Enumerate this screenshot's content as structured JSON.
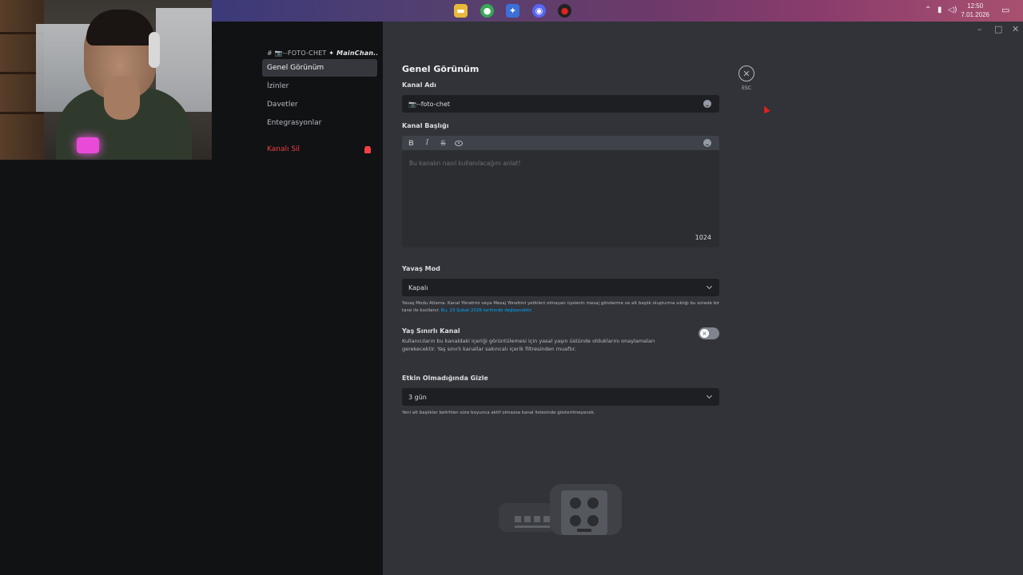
{
  "taskbar": {
    "clock_time": "12:50",
    "clock_date": "7.01.2026"
  },
  "sidebar": {
    "header_channel": "# 📷--FOTO-CHET",
    "header_category": "✦ MainChan...",
    "items": [
      {
        "label": "Genel Görünüm",
        "active": true
      },
      {
        "label": "İzinler"
      },
      {
        "label": "Davetler"
      },
      {
        "label": "Entegrasyonlar"
      }
    ],
    "delete_label": "Kanalı Sil"
  },
  "main": {
    "title": "Genel Görünüm",
    "channel_name_label": "Kanal Adı",
    "channel_name_value": "📷--foto-chet",
    "topic_label": "Kanal Başlığı",
    "topic_placeholder": "Bu kanalın nasıl kullanılacağını anlat!",
    "topic_counter": "1024",
    "toolbar": {
      "bold": "B",
      "italic": "I",
      "strike": "S"
    },
    "slowmode_label": "Yavaş Mod",
    "slowmode_value": "Kapalı",
    "slowmode_help": "Yavaş Modu Atlama. Kanal Yönetimi veya Mesaj Yönetimi yetkileri olmayan üyelerin mesaj gönderme ve alt başlık oluşturma sıklığı bu sürede bir tane ile kısıtlanır.",
    "slowmode_help_link": "Bu, 23 Şubat 2026 tarihinde değişecektir.",
    "nsfw_title": "Yaş Sınırlı Kanal",
    "nsfw_desc": "Kullanıcıların bu kanaldaki içeriği görüntülemesi için yasal yaşın üstünde olduklarını onaylamaları gerekecektir. Yaş sınırlı kanallar sakıncalı içerik filtresinden muaftır.",
    "nsfw_enabled": false,
    "archive_label": "Etkin Olmadığında Gizle",
    "archive_value": "3 gün",
    "archive_help": "Yeni alt başlıklar belirtilen süre boyunca aktif olmazsa kanal listesinde gösterilmeyecek.",
    "close_esc": "ESC"
  },
  "colors": {
    "danger": "#f23f43",
    "link": "#00a8fc",
    "background": "#313338"
  }
}
